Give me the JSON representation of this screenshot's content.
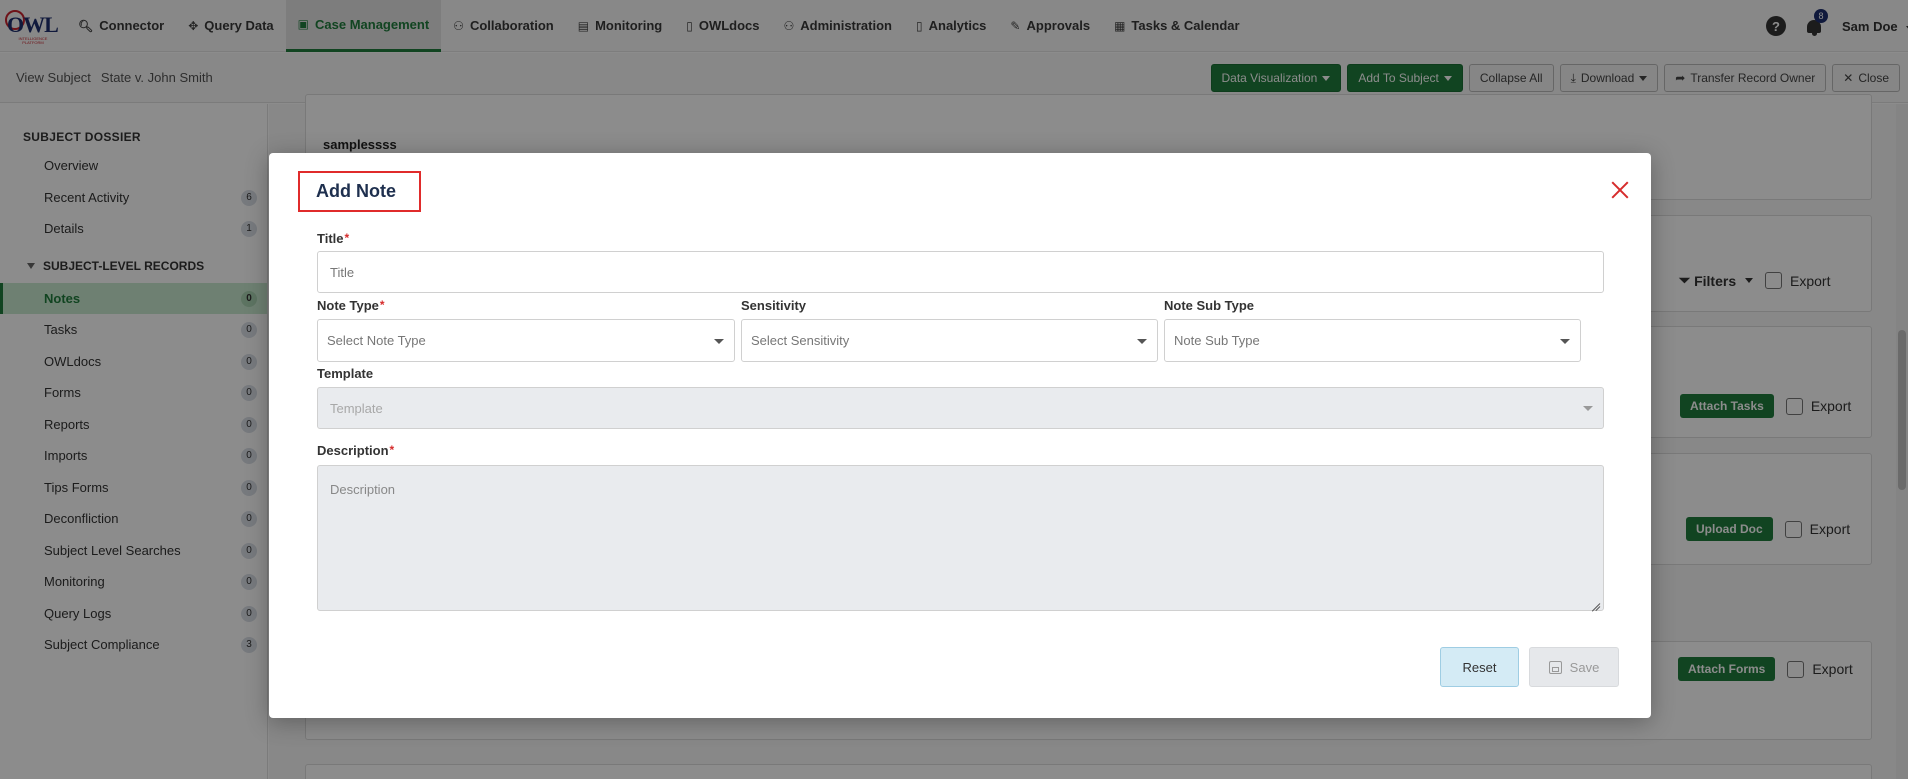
{
  "nav": {
    "items": [
      {
        "label": "Connector",
        "icon": "search-icon",
        "glyph": "🔍︎"
      },
      {
        "label": "Query Data",
        "icon": "move-icon",
        "glyph": "✥"
      },
      {
        "label": "Case Management",
        "icon": "folder-icon",
        "glyph": "▣",
        "active": true
      },
      {
        "label": "Collaboration",
        "icon": "users-icon",
        "glyph": "⚇"
      },
      {
        "label": "Monitoring",
        "icon": "monitor-icon",
        "glyph": "▤"
      },
      {
        "label": "OWLdocs",
        "icon": "document-icon",
        "glyph": "▯"
      },
      {
        "label": "Administration",
        "icon": "admin-icon",
        "glyph": "⚇"
      },
      {
        "label": "Analytics",
        "icon": "chart-file-icon",
        "glyph": "▯"
      },
      {
        "label": "Approvals",
        "icon": "approval-icon",
        "glyph": "✎"
      },
      {
        "label": "Tasks & Calendar",
        "icon": "calendar-icon",
        "glyph": "▦"
      }
    ],
    "notifications_count": "8",
    "user_name": "Sam Doe"
  },
  "subheader": {
    "view_label": "View Subject",
    "subject_name": "State v. John Smith",
    "buttons": {
      "data_visualization": "Data Visualization",
      "add_to_subject": "Add To Subject",
      "collapse_all": "Collapse All",
      "download": "Download",
      "transfer": "Transfer Record Owner",
      "close": "Close"
    }
  },
  "sidebar": {
    "dossier_title": "SUBJECT DOSSIER",
    "dossier_items": [
      {
        "label": "Overview",
        "count": ""
      },
      {
        "label": "Recent Activity",
        "count": "6"
      },
      {
        "label": "Details",
        "count": "1"
      }
    ],
    "records_title": "SUBJECT-LEVEL RECORDS",
    "records_items": [
      {
        "label": "Notes",
        "count": "0",
        "active": true
      },
      {
        "label": "Tasks",
        "count": "0"
      },
      {
        "label": "OWLdocs",
        "count": "0"
      },
      {
        "label": "Forms",
        "count": "0"
      },
      {
        "label": "Reports",
        "count": "0"
      },
      {
        "label": "Imports",
        "count": "0"
      },
      {
        "label": "Tips Forms",
        "count": "0"
      },
      {
        "label": "Deconfliction",
        "count": "0"
      },
      {
        "label": "Subject Level Searches",
        "count": "0"
      },
      {
        "label": "Monitoring",
        "count": "0"
      },
      {
        "label": "Query Logs",
        "count": "0"
      },
      {
        "label": "Subject Compliance",
        "count": "3"
      }
    ]
  },
  "background": {
    "samples_text": "samplessss",
    "filters_label": "Filters",
    "export_label": "Export",
    "attach_tasks": "Attach Tasks",
    "upload_doc": "Upload Doc",
    "attach_forms": "Attach Forms"
  },
  "modal": {
    "title": "Add Note",
    "title_label": "Title",
    "title_placeholder": "Title",
    "note_type_label": "Note Type",
    "note_type_placeholder": "Select Note Type",
    "sensitivity_label": "Sensitivity",
    "sensitivity_placeholder": "Select Sensitivity",
    "note_sub_type_label": "Note Sub Type",
    "note_sub_type_placeholder": "Note Sub Type",
    "template_label": "Template",
    "template_placeholder": "Template",
    "description_label": "Description",
    "description_placeholder": "Description",
    "required_mark": "*",
    "reset_label": "Reset",
    "save_label": "Save"
  },
  "colors": {
    "brand_green": "#1f7d3c",
    "navy": "#1e2f4e",
    "highlight_red": "#e02b2b"
  }
}
